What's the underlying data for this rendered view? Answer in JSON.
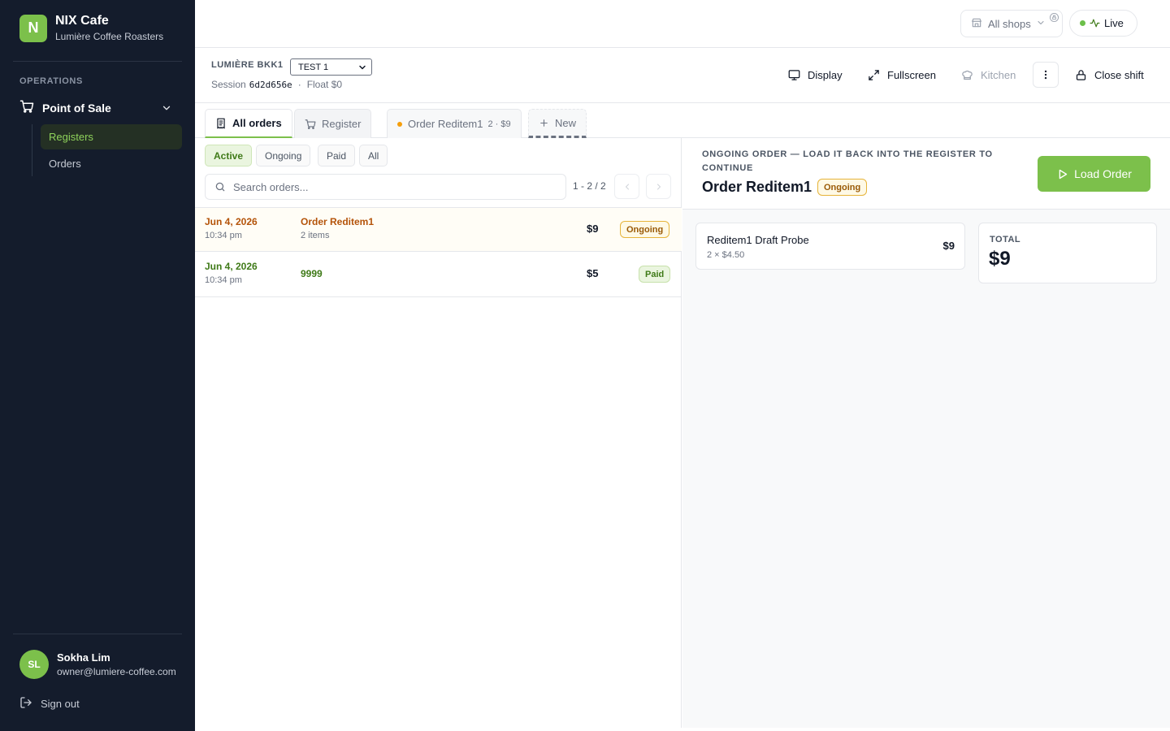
{
  "brand": {
    "initial": "N",
    "name": "NIX Cafe",
    "subtitle": "Lumière Coffee Roasters"
  },
  "sidebar": {
    "section_label": "OPERATIONS",
    "group_label": "Point of Sale",
    "items": [
      {
        "label": "Registers",
        "active": true
      },
      {
        "label": "Orders",
        "active": false
      }
    ]
  },
  "user": {
    "initials": "SL",
    "name": "Sokha Lim",
    "email": "owner@lumiere-coffee.com",
    "sign_out": "Sign out"
  },
  "topbar": {
    "shops_label": "All shops",
    "live_label": "Live"
  },
  "session": {
    "register_name": "LUMIÈRE BKK1",
    "register_select": "TEST 1",
    "session_label": "Session",
    "session_id": "6d2d656e",
    "separator": "·",
    "float_label": "Float $0"
  },
  "actions": {
    "display": "Display",
    "fullscreen": "Fullscreen",
    "kitchen": "Kitchen",
    "close_shift": "Close shift"
  },
  "tabs": {
    "all_orders": "All orders",
    "register": "Register",
    "order_tab": {
      "label": "Order Reditem1",
      "meta": "2 · $9"
    },
    "new": "New"
  },
  "filters": [
    "Active",
    "Ongoing",
    "Paid",
    "All"
  ],
  "search": {
    "placeholder": "Search orders..."
  },
  "pager": {
    "text": "1 - 2 / 2"
  },
  "orders": [
    {
      "date": "Jun 4, 2026",
      "time": "10:34 pm",
      "title": "Order Reditem1",
      "sub": "2 items",
      "amount": "$9",
      "status": "Ongoing"
    },
    {
      "date": "Jun 4, 2026",
      "time": "10:34 pm",
      "title": "9999",
      "sub": "",
      "amount": "$5",
      "status": "Paid"
    }
  ],
  "detail": {
    "label": "Ongoing order — load it back into the register to continue",
    "title": "Order Reditem1",
    "status": "Ongoing",
    "load_button": "Load Order",
    "item": {
      "name": "Reditem1 Draft Probe",
      "qty": "2 × $4.50",
      "price": "$9"
    },
    "total_label": "TOTAL",
    "total_value": "$9"
  },
  "colors": {
    "accent": "#7cc04b",
    "sidebar_bg": "#141c2c",
    "ongoing": "#b45309",
    "paid": "#3f7a18"
  }
}
